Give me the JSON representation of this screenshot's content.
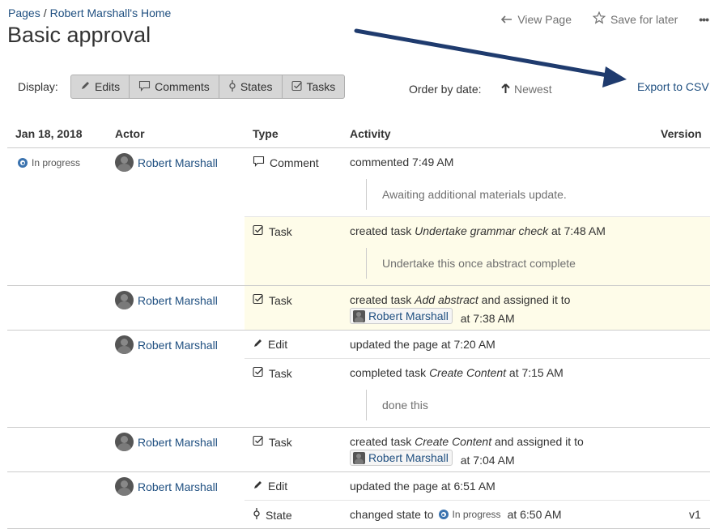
{
  "breadcrumb": {
    "root": "Pages",
    "sep": "/",
    "parent": "Robert Marshall's Home"
  },
  "page_title": "Basic approval",
  "actions": {
    "view": "View Page",
    "save": "Save for later",
    "more": "•••"
  },
  "toolbar": {
    "display_label": "Display:",
    "filters": [
      "Edits",
      "Comments",
      "States",
      "Tasks"
    ],
    "order_label": "Order by date:",
    "order_value": "Newest",
    "export": "Export to CSV"
  },
  "columns": {
    "date": "Jan 18, 2018",
    "actor": "Actor",
    "type": "Type",
    "activity": "Activity",
    "version": "Version"
  },
  "state": {
    "label": "In progress",
    "color": "#3b73af"
  },
  "actor_name": "Robert Marshall",
  "rows": [
    {
      "type": "Comment",
      "pre": "commented 7:49 AM",
      "quote": "Awaiting additional materials update."
    },
    {
      "type": "Task",
      "pre": "created task ",
      "em": "Undertake grammar check",
      "post": " at 7:48 AM",
      "quote": "Undertake this once abstract complete"
    },
    {
      "type": "Task",
      "pre": "created task ",
      "em": "Add abstract",
      "post": " and assigned it to",
      "time": "at 7:38 AM"
    },
    {
      "type": "Edit",
      "pre": "updated the page at 7:20 AM"
    },
    {
      "type": "Task",
      "pre": "completed task ",
      "em": "Create Content",
      "post": " at 7:15 AM",
      "quote": "done this"
    },
    {
      "type": "Task",
      "pre": "created task ",
      "em": "Create Content",
      "post": " and assigned it to",
      "time": "at 7:04 AM"
    },
    {
      "type": "Edit",
      "pre": "updated the page at 6:51 AM"
    },
    {
      "type": "State",
      "pre": "changed state to",
      "time": "at 6:50 AM",
      "version": "v1"
    }
  ],
  "colors": {
    "link": "#205081",
    "highlight": "#fefce9",
    "arrow": "#1f3b6e"
  }
}
